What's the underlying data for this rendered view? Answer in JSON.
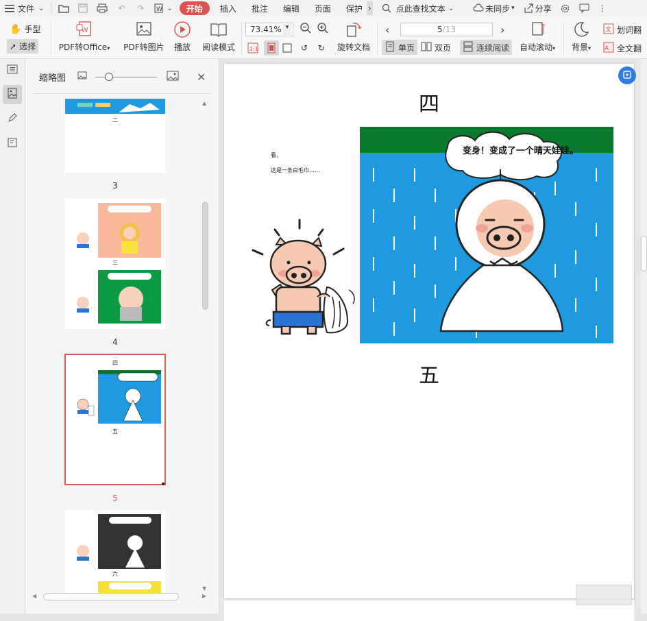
{
  "menu": {
    "file": "文件",
    "tabs": [
      {
        "label": "开始",
        "active": true
      },
      {
        "label": "插入"
      },
      {
        "label": "批注"
      },
      {
        "label": "编辑"
      },
      {
        "label": "页面"
      },
      {
        "label": "保护"
      }
    ],
    "search": "点此查找文本",
    "sync": "未同步",
    "share": "分享"
  },
  "ribbon": {
    "hand": "手型",
    "select": "选择",
    "pdf_to_office": "PDF转Office",
    "pdf_to_image": "PDF转图片",
    "play": "播放",
    "read_mode": "阅读模式",
    "zoom": "73.41%",
    "rotate": "旋转文档",
    "page_current": "5",
    "page_total": "/13",
    "single": "单页",
    "double": "双页",
    "continuous": "连续阅读",
    "auto_scroll": "自动滚动",
    "background": "背景",
    "word_translate": "划词翻",
    "full_translate": "全文翻"
  },
  "thumbnail_panel": {
    "title": "缩略图",
    "pages": [
      {
        "number": "3",
        "caption": "二"
      },
      {
        "number": "4",
        "caption": "三"
      },
      {
        "number": "5",
        "caption": "四",
        "caption2": "五",
        "selected": true
      },
      {
        "number": "6",
        "caption": "六"
      }
    ]
  },
  "page_content": {
    "heading": "四",
    "footer_heading": "五",
    "narration_line1": "看，",
    "narration_line2": "这是一条白毛巾……",
    "speech_bubble": "变身！变成了一个晴天娃娃。"
  },
  "colors": {
    "accent": "#d9534f",
    "rain_blue": "#1e9be0",
    "grass_green": "#0a7a2a",
    "pig_pink": "#f7c9b1",
    "shorts_blue": "#2a74d6",
    "thumb_select": "#e05a5a"
  }
}
